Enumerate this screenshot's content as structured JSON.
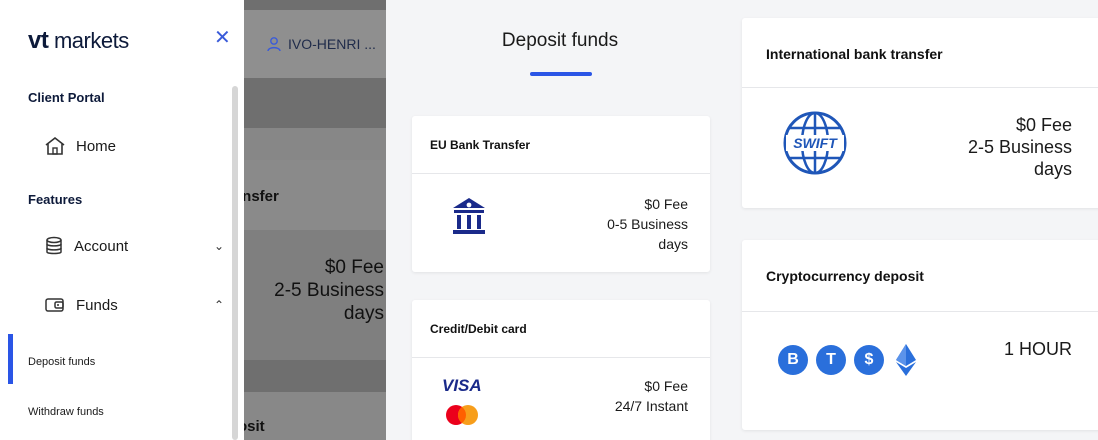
{
  "colors": {
    "accent": "#2a55e6",
    "brand_navy": "#0d1a3a",
    "crypto_blue": "#2a6fdb",
    "swift_blue": "#1f56b8",
    "visa_blue": "#1a2a8a"
  },
  "sidebar": {
    "logo_vt": "vt",
    "logo_rest": " markets",
    "close_icon": "close-icon",
    "user_name": "IVO-HENRI ...",
    "section_portal": "Client Portal",
    "home_label": "Home",
    "section_features": "Features",
    "account_label": "Account",
    "funds_label": "Funds",
    "deposit_label": "Deposit funds",
    "withdraw_label": "Withdraw funds"
  },
  "background_page": {
    "transfer_fragment": "insfer",
    "fee": "$0 Fee",
    "time": "2-5 Business days",
    "deposit_fragment": "osit"
  },
  "deposit": {
    "title": "Deposit funds",
    "eu": {
      "title": "EU Bank Transfer",
      "fee": "$0 Fee",
      "time_1": "0-5 Business",
      "time_2": "days"
    },
    "card": {
      "title": "Credit/Debit card",
      "visa": "VISA",
      "fee": "$0 Fee",
      "time": "24/7 Instant"
    }
  },
  "international": {
    "title": "International bank transfer",
    "swift": "SWIFT",
    "fee": "$0 Fee",
    "time_1": "2-5 Business",
    "time_2": "days"
  },
  "crypto": {
    "title": "Cryptocurrency deposit",
    "time": "1 HOUR",
    "coins": [
      "B",
      "T",
      "$"
    ]
  }
}
